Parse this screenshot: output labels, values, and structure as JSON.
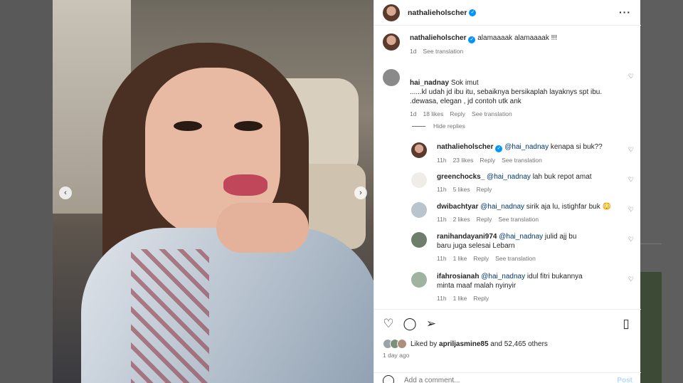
{
  "post": {
    "author": "nathalieholscher",
    "caption": "alamaaaak alamaaaak !!!",
    "caption_time": "1d",
    "caption_translate": "See translation"
  },
  "comments": [
    {
      "user": "hai_nadnay",
      "text": "Sok imut\n......kl udah jd ibu itu, sebaiknya bersikaplah layaknys spt ibu.\n.dewasa, elegan , jd contoh utk ank",
      "time": "1d",
      "likes": "18 likes",
      "reply": "Reply",
      "translate": "See translation"
    }
  ],
  "hide_replies": "Hide replies",
  "replies": [
    {
      "user": "nathalieholscher",
      "mention": "@hai_nadnay",
      "text": "kenapa si buk??",
      "time": "11h",
      "likes": "23 likes",
      "reply": "Reply",
      "translate": "See translation"
    },
    {
      "user": "greenchocks_",
      "mention": "@hai_nadnay",
      "text": "lah buk repot amat",
      "time": "11h",
      "likes": "5 likes",
      "reply": "Reply"
    },
    {
      "user": "dwibachtyar",
      "mention": "@hai_nadnay",
      "text": "sirik aja lu, istighfar buk 😳",
      "time": "11h",
      "likes": "2 likes",
      "reply": "Reply",
      "translate": "See translation"
    },
    {
      "user": "ranihandayani974",
      "mention": "@hai_nadnay",
      "text": "julid ajj bu baru juga selesai Lebarn",
      "time": "11h",
      "likes": "1 like",
      "reply": "Reply",
      "translate": "See translation"
    },
    {
      "user": "ifahrosianah",
      "mention": "@hai_nadnay",
      "text": "idul fitri bukannya minta maaf malah nyinyir",
      "time": "11h",
      "likes": "1 like",
      "reply": "Reply"
    }
  ],
  "likes_line": {
    "prefix": "Liked by ",
    "user": "apriljasmine85",
    "suffix": " and 52,465 others"
  },
  "time_ago": "1 day ago",
  "add_comment": {
    "placeholder": "Add a comment...",
    "post": "Post"
  },
  "icons": [
    "heart-icon",
    "comment-icon",
    "share-icon",
    "bookmark-icon",
    "more-icon",
    "emoji-icon",
    "chevron-left-icon",
    "chevron-right-icon",
    "verified-icon"
  ],
  "colors": {
    "link": "#00376b",
    "verified": "#0095f6",
    "secondary": "#737373",
    "post_disabled": "#b3dbff"
  }
}
